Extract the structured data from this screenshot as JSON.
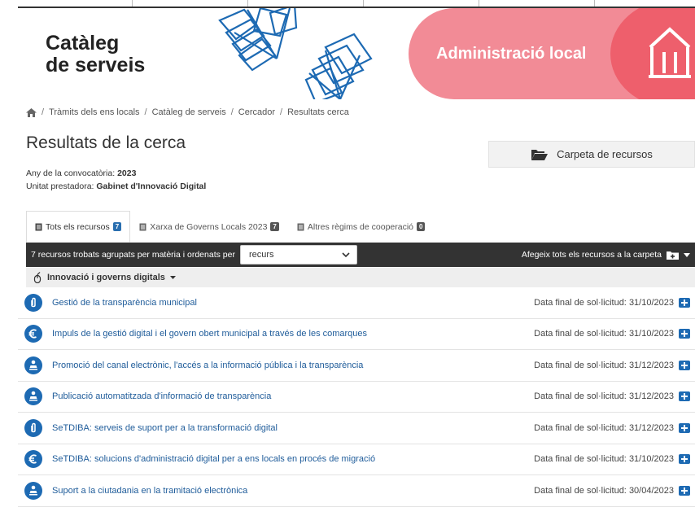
{
  "banner": {
    "brand_line1": "Catàleg",
    "brand_line2": "de serveis",
    "admin_label": "Administració local"
  },
  "breadcrumb": {
    "home_icon": "home-icon",
    "items": [
      "Tràmits dels ens locals",
      "Catàleg de serveis",
      "Cercador",
      "Resultats cerca"
    ]
  },
  "page_title": "Resultats de la cerca",
  "carpeta_button": "Carpeta de recursos",
  "meta": {
    "year_label": "Any de la convocatòria:",
    "year_value": "2023",
    "unit_label": "Unitat prestadora:",
    "unit_value": "Gabinet d'Innovació Digital"
  },
  "tabs": [
    {
      "label": "Tots els recursos",
      "count": "7",
      "active": true
    },
    {
      "label": "Xarxa de Governs Locals 2023",
      "count": "7",
      "active": false
    },
    {
      "label": "Altres règims de cooperació",
      "count": "0",
      "active": false
    }
  ],
  "toolbar": {
    "summary": "7 recursos trobats agrupats per matèria i ordenats per",
    "sort_value": "recurs",
    "add_all": "Afegeix tots els recursos a la carpeta"
  },
  "group": {
    "label": "Innovació i governs digitals"
  },
  "colors": {
    "accent_blue": "#1d6ab3",
    "link_blue": "#1f5c9a",
    "banner_pink": "#f28b96",
    "banner_red": "#ee5f6c",
    "toolbar_dark": "#333333"
  },
  "rows": [
    {
      "icon": "paperclip-icon",
      "title": "Gestió de la transparència municipal",
      "date_label": "Data final de sol·licitud:",
      "date": "31/10/2023"
    },
    {
      "icon": "euro-icon",
      "title": "Impuls de la gestió digital i el govern obert municipal a través de les comarques",
      "date_label": "Data final de sol·licitud:",
      "date": "31/10/2023"
    },
    {
      "icon": "person-icon",
      "title": "Promoció del canal electrònic, l'accés a la informació pública i la transparència",
      "date_label": "Data final de sol·licitud:",
      "date": "31/12/2023"
    },
    {
      "icon": "person-icon",
      "title": "Publicació automatitzada d'informació de transparència",
      "date_label": "Data final de sol·licitud:",
      "date": "31/12/2023"
    },
    {
      "icon": "paperclip-icon",
      "title": "SeTDIBA: serveis de suport per a la transformació digital",
      "date_label": "Data final de sol·licitud:",
      "date": "31/12/2023"
    },
    {
      "icon": "euro-icon",
      "title": "SeTDIBA: solucions d'administració digital per a ens locals en procés de migració",
      "date_label": "Data final de sol·licitud:",
      "date": "31/10/2023"
    },
    {
      "icon": "person-icon",
      "title": "Suport a la ciutadania en la tramitació electrònica",
      "date_label": "Data final de sol·licitud:",
      "date": "30/04/2023"
    }
  ]
}
